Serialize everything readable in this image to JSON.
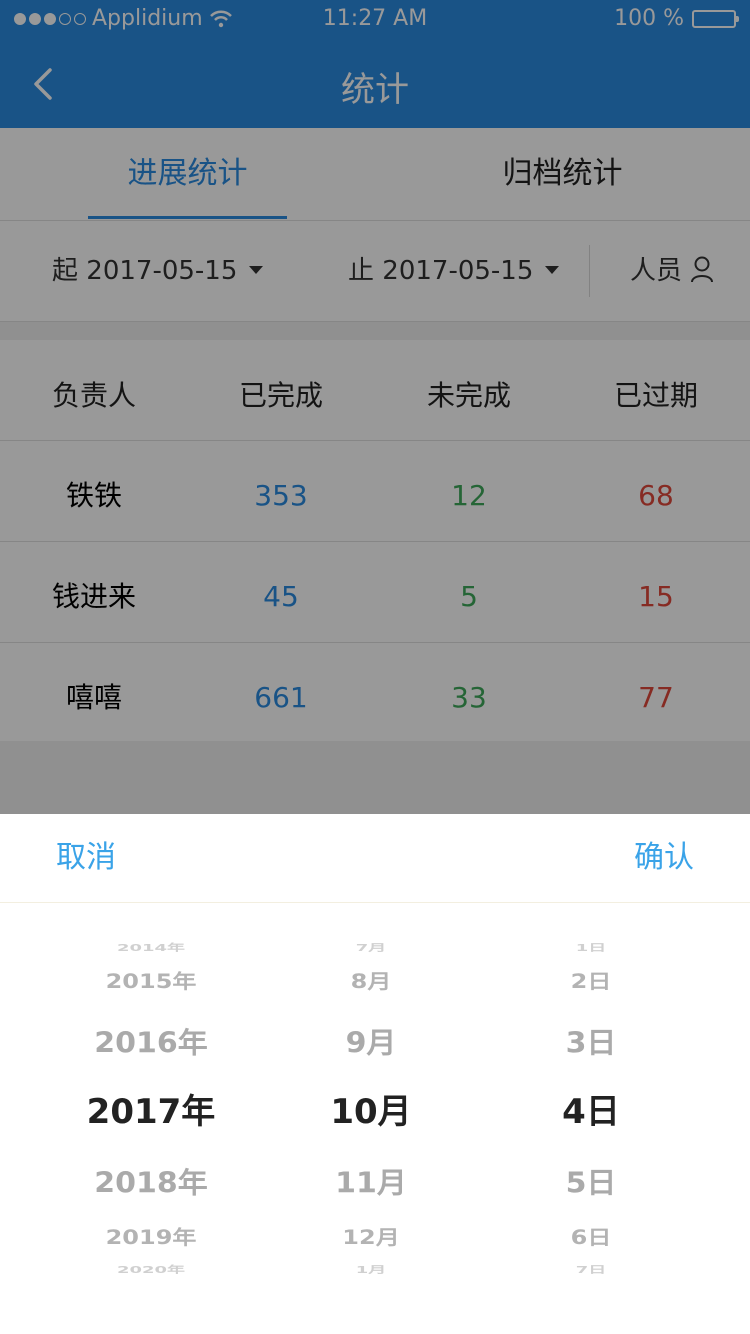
{
  "status": {
    "carrier": "Applidium",
    "time": "11:27 AM",
    "battery": "100 %"
  },
  "nav": {
    "title": "统计"
  },
  "tabs": [
    {
      "label": "进展统计",
      "active": true
    },
    {
      "label": "归档统计",
      "active": false
    }
  ],
  "filter": {
    "start_prefix": "起",
    "start_date": "2017-05-15",
    "end_prefix": "止",
    "end_date": "2017-05-15",
    "person_label": "人员"
  },
  "table": {
    "headers": [
      "负责人",
      "已完成",
      "未完成",
      "已过期"
    ],
    "rows": [
      {
        "name": "铁铁",
        "done": "353",
        "undone": "12",
        "expired": "68"
      },
      {
        "name": "钱进来",
        "done": "45",
        "undone": "5",
        "expired": "15"
      },
      {
        "name": "嘻嘻",
        "done": "661",
        "undone": "33",
        "expired": "77"
      }
    ]
  },
  "picker": {
    "cancel": "取消",
    "confirm": "确认",
    "years": [
      "2014年",
      "2015年",
      "2016年",
      "2017年",
      "2018年",
      "2019年",
      "2020年"
    ],
    "months": [
      "7月",
      "8月",
      "9月",
      "10月",
      "11月",
      "12月",
      "1月"
    ],
    "days": [
      "1日",
      "2日",
      "3日",
      "4日",
      "5日",
      "6日",
      "7日"
    ],
    "selected_index": 3
  },
  "colors": {
    "primary": "#2a8ae0",
    "done": "#2a8ae0",
    "undone": "#3ea85a",
    "expired": "#e0483b",
    "picker_button": "#3aa3e8"
  },
  "icons": {
    "back": "chevron-left-icon",
    "caret": "caret-down-icon",
    "person": "person-icon",
    "wifi": "wifi-icon",
    "battery": "battery-icon"
  }
}
